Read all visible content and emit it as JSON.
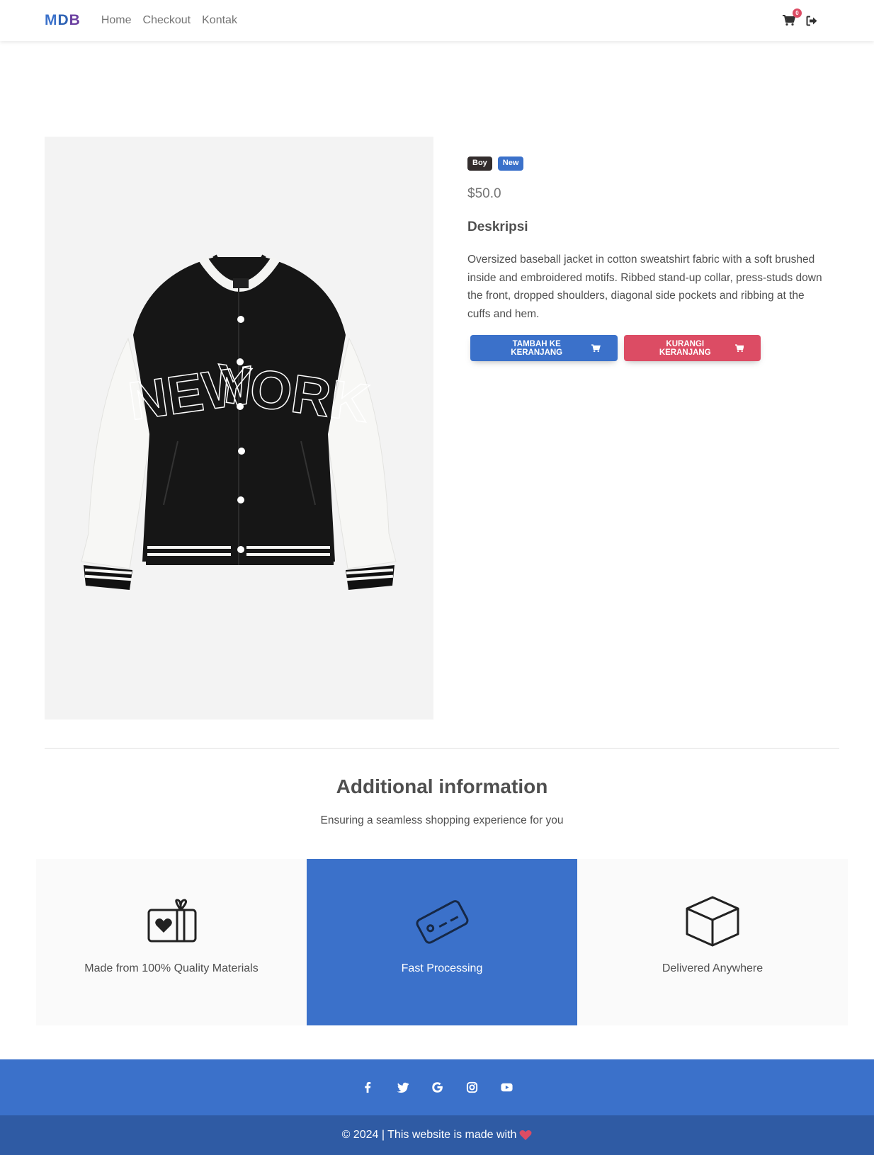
{
  "navbar": {
    "brand": {
      "m": "M",
      "d": "D",
      "b": "B"
    },
    "links": [
      "Home",
      "Checkout",
      "Kontak"
    ],
    "cart_count": "0",
    "icons": [
      "cart-icon",
      "logout-icon"
    ]
  },
  "product": {
    "badges": [
      "Boy",
      "New"
    ],
    "price": "$50.0",
    "description_title": "Deskripsi",
    "description": "Oversized baseball jacket in cotton sweatshirt fabric with a soft brushed inside and embroidered motifs. Ribbed stand-up collar, press-studs down the front, dropped shoulders, diagonal side pockets and ribbing at the cuffs and hem.",
    "add_button": "TAMBAH KE KERANJANG",
    "remove_button": "KURANGI KERANJANG",
    "jacket_text_left": "NEW",
    "jacket_text_right": "YORK"
  },
  "additional": {
    "title": "Additional information",
    "subtitle": "Ensuring a seamless shopping experience for you",
    "features": [
      {
        "label": "Made from 100% Quality Materials",
        "icon": "gift-heart-icon"
      },
      {
        "label": "Fast Processing",
        "icon": "credit-card-icon"
      },
      {
        "label": "Delivered Anywhere",
        "icon": "box-icon"
      }
    ]
  },
  "footer": {
    "social_icons": [
      "facebook-icon",
      "twitter-icon",
      "google-icon",
      "instagram-icon",
      "youtube-icon"
    ],
    "copyright": "© 2024 | This website is made with"
  },
  "colors": {
    "primary": "#3b71ca",
    "danger": "#dc4c64",
    "dark": "#332d2d",
    "footer_bottom": "#2f5ba4"
  }
}
